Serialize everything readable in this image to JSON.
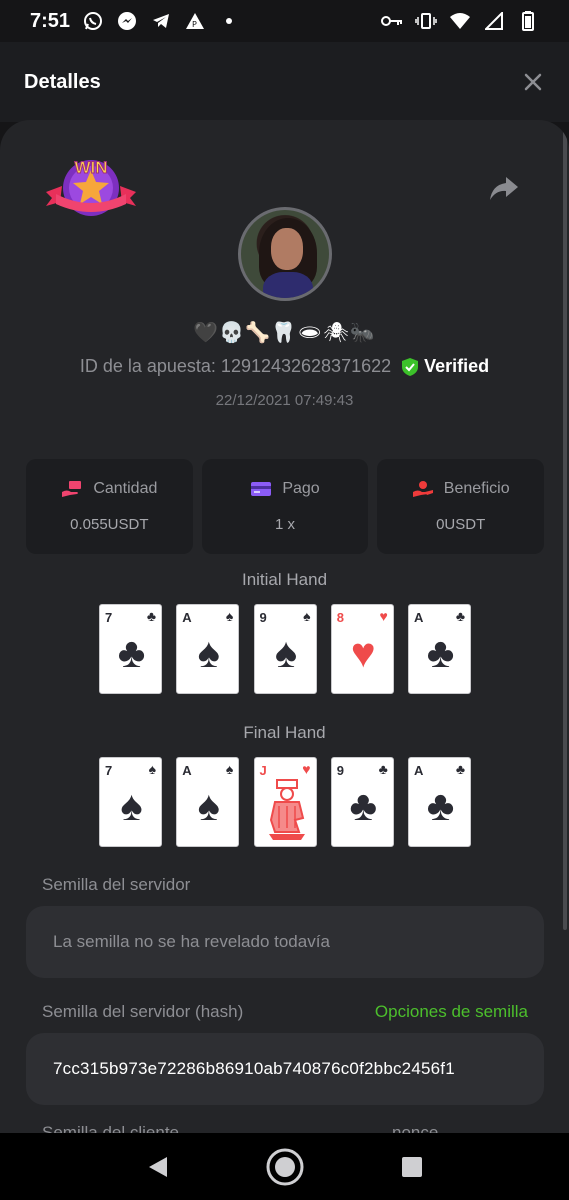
{
  "status_bar": {
    "time": "7:51"
  },
  "header": {
    "title": "Detalles"
  },
  "player": {
    "username": "🖤💀🦴🦷🕳🕷🐜",
    "bet_id": "ID de la apuesta: 12912432628371622",
    "verified_label": "Verified",
    "date": "22/12/2021 07:49:43"
  },
  "badge": {
    "text": "WIN"
  },
  "stats": [
    {
      "label": "Cantidad",
      "value": "0.055USDT",
      "icon": "money-hand-icon"
    },
    {
      "label": "Pago",
      "value": "1 x",
      "icon": "card-icon"
    },
    {
      "label": "Beneficio",
      "value": "0USDT",
      "icon": "profit-hand-icon"
    }
  ],
  "hands": {
    "initial_title": "Initial Hand",
    "initial": [
      {
        "rank": "7",
        "suit": "♣",
        "color": "black"
      },
      {
        "rank": "A",
        "suit": "♠",
        "color": "black"
      },
      {
        "rank": "9",
        "suit": "♠",
        "color": "black"
      },
      {
        "rank": "8",
        "suit": "♥",
        "color": "red"
      },
      {
        "rank": "A",
        "suit": "♣",
        "color": "black"
      }
    ],
    "final_title": "Final Hand",
    "final": [
      {
        "rank": "7",
        "suit": "♠",
        "color": "black"
      },
      {
        "rank": "A",
        "suit": "♠",
        "color": "black"
      },
      {
        "rank": "J",
        "suit": "♥",
        "color": "red"
      },
      {
        "rank": "9",
        "suit": "♣",
        "color": "black"
      },
      {
        "rank": "A",
        "suit": "♣",
        "color": "black"
      }
    ]
  },
  "seeds": {
    "server_seed_label": "Semilla del servidor",
    "server_seed_value": "La semilla no se ha revelado todavía",
    "server_hash_label": "Semilla del servidor (hash)",
    "seed_options_link": "Opciones de semilla",
    "server_hash_value": "7cc315b973e72286b86910ab740876c0f2bbc2456f1",
    "client_seed_label": "Semilla del cliente",
    "nonce_label": "nonce"
  },
  "colors": {
    "accent_green": "#4cbf2c",
    "card_red": "#ef4b4b",
    "sheet_bg": "#242528"
  }
}
